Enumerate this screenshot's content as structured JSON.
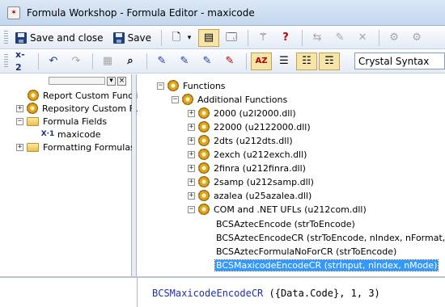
{
  "window": {
    "title": "Formula Workshop - Formula Editor - maxicode"
  },
  "toolbar1": {
    "save_close_label": "Save and close",
    "save_label": "Save"
  },
  "toolbar2": {
    "syntax_select_value": "Crystal Syntax"
  },
  "workshop_tree": {
    "items": [
      {
        "label": "Report Custom Functi",
        "icon": "gear-icon"
      },
      {
        "label": "Repository Custom Fu",
        "icon": "gear-icon"
      },
      {
        "label": "Formula Fields",
        "icon": "folder-icon"
      },
      {
        "label": "maxicode",
        "icon": "formula-icon"
      },
      {
        "label": "Formatting Formulas",
        "icon": "folder-icon"
      }
    ]
  },
  "function_tree": {
    "root_label": "Functions",
    "additional_label": "Additional Functions",
    "dlls": [
      "2000 (u2l2000.dll)",
      "22000 (u2122000.dll)",
      "2dts (u212dts.dll)",
      "2exch (u212exch.dll)",
      "2finra (u212finra.dll)",
      "2samp (u212samp.dll)",
      "azalea (u25azalea.dll)",
      "COM and .NET UFLs (u212com.dll)"
    ],
    "functions": [
      "BCSAztecEncode (strToEncode)",
      "BCSAztecEncodeCR (strToEncode, nIndex, nFormat, nError",
      "BCSAztecFormulaNoForCR (strToEncode)",
      "BCSMaxicodeEncodeCR (strInput, nIndex, nMode)"
    ]
  },
  "formula": {
    "function_name": "BCSMaxicodeEncodeCR",
    "arguments": " ({Data.Code}, 1, 3)"
  }
}
